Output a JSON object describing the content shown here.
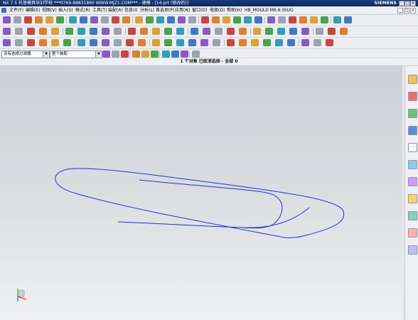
{
  "titlebar": {
    "title": "NX 7.5 托普模具培训学校  ***0769-88831860  WWW.MJZ1.COM***  - 建模 - [14.prt (修改的)]",
    "brand": "SIEMENS",
    "buttons": [
      "_",
      "□",
      "×"
    ]
  },
  "menubar": {
    "items": [
      "文件(F)",
      "编辑(E)",
      "视图(V)",
      "插入(S)",
      "格式(R)",
      "工具(T)",
      "装配(A)",
      "信息(I)",
      "分析(L)",
      "首选项(P)",
      "应用(N)",
      "窗口(O)",
      "电极(D)",
      "帮助(H)",
      "HB_MOULD M6.6",
      "3SUG"
    ],
    "window_controls": [
      "_",
      "□",
      "×"
    ]
  },
  "selection_bar": {
    "filter_value": "没有选择过滤器",
    "scope_value": "整个装配"
  },
  "status": {
    "message": "1 个对象 已取消选择 · 全部 0"
  },
  "icons": {
    "row1": [
      "new-icon",
      "open-icon",
      "save-icon",
      "cut-icon",
      "copy-icon",
      "paste-icon",
      "undo-icon",
      "redo-icon",
      "fit-icon",
      "zoom-icon",
      "rotate-icon",
      "pan-icon",
      "shaded-icon",
      "wireframe-icon",
      "layer-icon",
      "wcs-icon",
      "measure-icon",
      "section-icon",
      "render-icon",
      "sketch-icon",
      "extrude-icon",
      "revolve-icon",
      "hole-icon",
      "boss-icon",
      "pocket-icon",
      "pad-icon",
      "blend-icon",
      "chamfer-icon",
      "shell-icon",
      "unite-icon",
      "subtract-icon",
      "intersect-icon"
    ],
    "row2": [
      "point-icon",
      "datum-plane-icon",
      "datum-axis-icon",
      "csys-icon",
      "box-icon",
      "cylinder-icon",
      "cone-icon",
      "sphere-icon",
      "edge-blend-icon",
      "draft-icon",
      "trim-body-icon",
      "split-body-icon",
      "mirror-icon",
      "pattern-icon",
      "offset-face-icon",
      "thicken-icon",
      "scale-icon",
      "wrap-icon",
      "emboss-icon",
      "replace-face-icon",
      "sew-icon",
      "patch-icon",
      "delete-face-icon",
      "move-face-icon",
      "resize-icon",
      "color-icon",
      "hide-icon",
      "show-icon"
    ],
    "row3": [
      "undo-icon",
      "line-icon",
      "rectangle-icon",
      "text-icon",
      "arc-icon",
      "circle-icon",
      "fillet-icon",
      "chamfer-curve-icon",
      "spline-icon",
      "offset-curve-icon",
      "project-icon",
      "intersect-curve-icon",
      "bridge-icon",
      "join-icon",
      "extract-icon",
      "isoparam-icon",
      "helix-icon",
      "law-icon",
      "trim-curve-icon",
      "split-curve-icon",
      "edit-param-icon",
      "divide-icon",
      "length-icon",
      "through-curves-icon",
      "mesh-icon",
      "sweep-icon",
      "ruled-icon"
    ],
    "row4": [
      "filter-icon",
      "snap-endpoint-icon",
      "snap-midpoint-icon",
      "snap-center-icon",
      "snap-quadrant-icon",
      "snap-intersection-icon",
      "snap-existing-icon",
      "snap-on-curve-icon",
      "snap-on-face-icon",
      "snap-point-icon"
    ],
    "resource_bar": [
      "assembly-navigator-icon",
      "constraint-navigator-icon",
      "part-navigator-icon",
      "reuse-library-icon",
      "history-icon",
      "system-materials-icon",
      "palette-icon",
      "role-icon",
      "web-browser-icon",
      "process-studio-icon",
      "hd3d-icon"
    ]
  }
}
